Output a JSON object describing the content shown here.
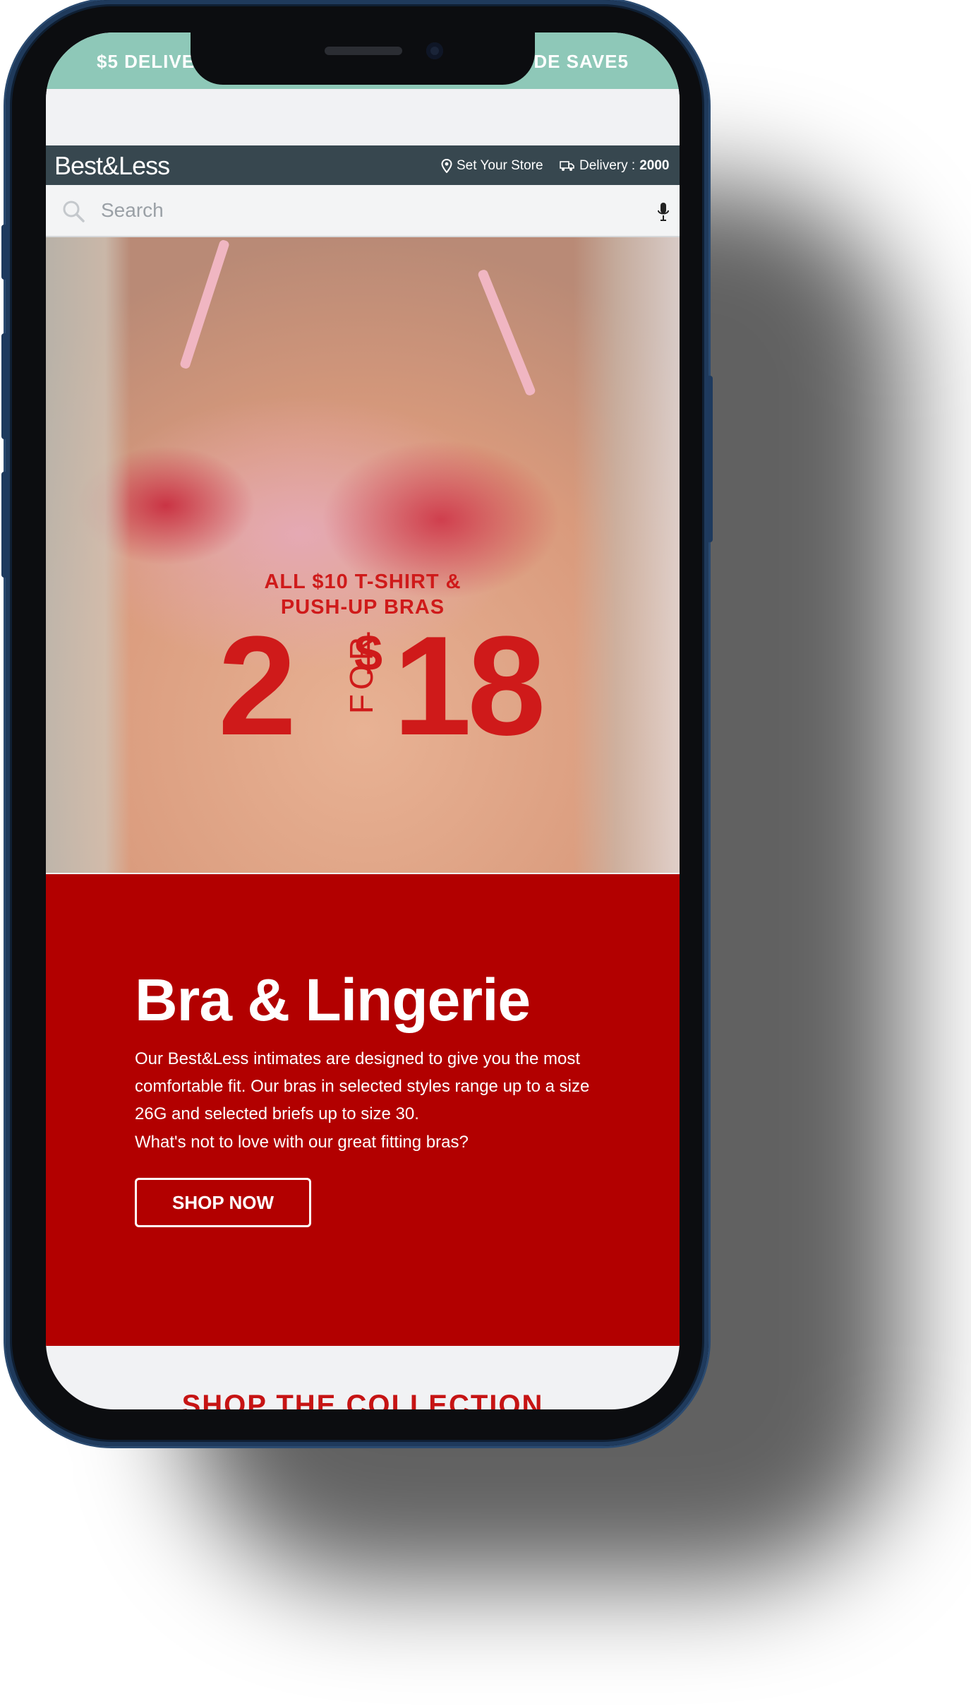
{
  "promo_bar": {
    "left_text": "$5 DELIVE",
    "right_text": "DE SAVE5"
  },
  "header": {
    "logo": "Best&Less",
    "store_label": "Set Your Store",
    "delivery_label": "Delivery :",
    "delivery_postcode": "2000"
  },
  "search": {
    "placeholder": "Search"
  },
  "hero": {
    "promo_line1": "ALL $10 T-SHIRT &",
    "promo_line2": "PUSH-UP BRAS",
    "offer_quantity": "2",
    "offer_for": "FOR",
    "offer_dollar": "$",
    "offer_price": "18"
  },
  "content": {
    "title": "Bra & Lingerie",
    "description": "Our Best&Less intimates are designed to give you the most comfortable fit. Our bras in selected styles range up to a size 26G and selected briefs up to size 30.",
    "question": "What's not to love with our great fitting bras?",
    "cta_label": "SHOP NOW"
  },
  "collection_heading": "SHOP THE COLLECTION",
  "colors": {
    "promo_bg": "#8ec8b8",
    "header_bg": "#37474f",
    "brand_red": "#b20000",
    "offer_red": "#cf1a1a"
  },
  "icons": [
    "location-pin-icon",
    "delivery-truck-icon",
    "search-icon",
    "microphone-icon"
  ]
}
